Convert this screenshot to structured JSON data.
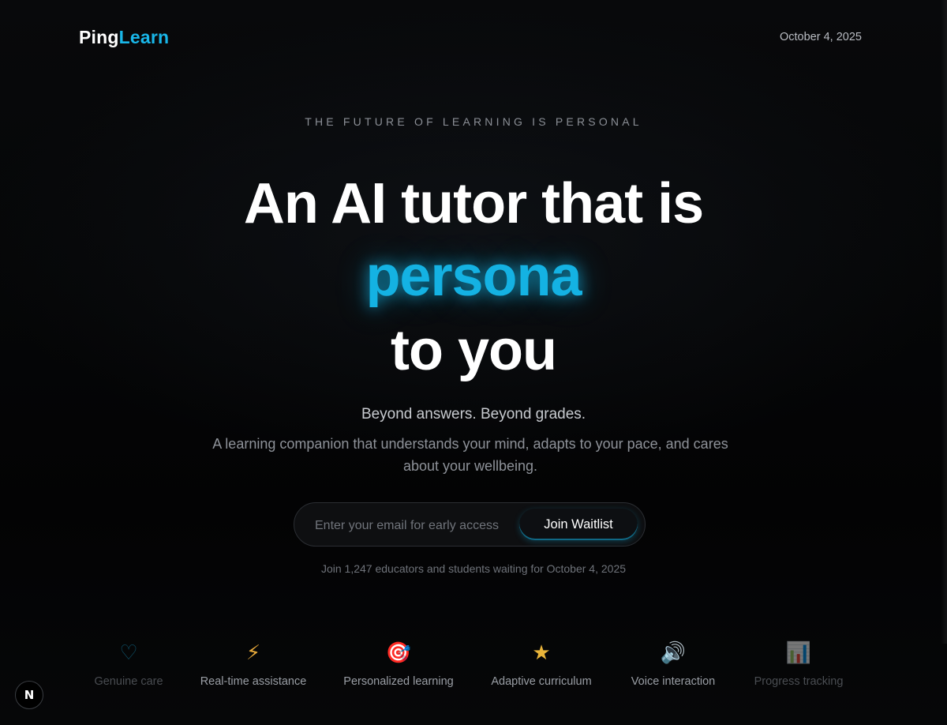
{
  "brand": {
    "part1": "Ping",
    "part2": "Learn",
    "accent": "#19b6e8"
  },
  "header": {
    "date": "October 4, 2025"
  },
  "hero": {
    "eyebrow": "THE FUTURE OF LEARNING IS PERSONAL",
    "line1": "An AI tutor that is",
    "line2": "persona",
    "line3": "to you",
    "subtitle": "Beyond answers. Beyond grades.",
    "description": "A learning companion that understands your mind, adapts to your pace, and cares about your wellbeing."
  },
  "waitlist": {
    "placeholder": "Enter your email for early access",
    "button": "Join Waitlist",
    "note": "Join 1,247 educators and students waiting for October 4, 2025"
  },
  "features": [
    {
      "icon": "heart-icon",
      "glyph": "♡",
      "label": "Genuine care",
      "color": "#19a9d8"
    },
    {
      "icon": "lightning-icon",
      "glyph": "⚡",
      "label": "Real-time assistance",
      "color": "#e7a93a"
    },
    {
      "icon": "target-icon",
      "glyph": "🎯",
      "label": "Personalized learning",
      "color": "#d9483a"
    },
    {
      "icon": "star-icon",
      "glyph": "★",
      "label": "Adaptive curriculum",
      "color": "#e9b43a"
    },
    {
      "icon": "speaker-icon",
      "glyph": "🔊",
      "label": "Voice interaction",
      "color": "#9aa0a8"
    },
    {
      "icon": "bar-chart-icon",
      "glyph": "📊",
      "label": "Progress tracking",
      "color": "#c9cdd2"
    }
  ],
  "badge": {
    "label": "N",
    "icon": "nextjs-badge-icon"
  }
}
